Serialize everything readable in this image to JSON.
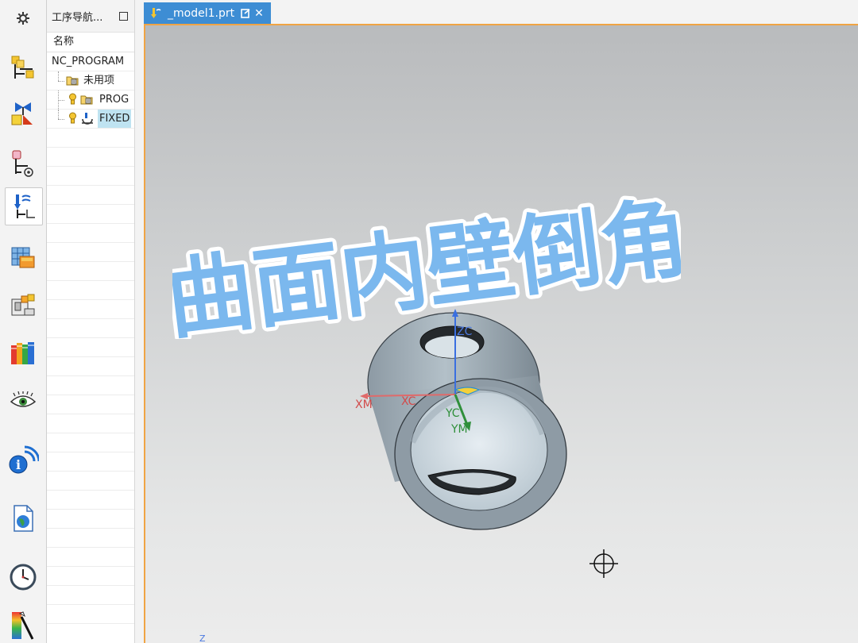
{
  "rail": {
    "items": [
      {
        "icon": "settings-gear-icon"
      },
      {
        "icon": "program-order-view-icon"
      },
      {
        "icon": "machine-tool-view-icon"
      },
      {
        "icon": "geometry-view-icon"
      },
      {
        "icon": "operation-navigator-icon",
        "active": true
      },
      {
        "icon": "machining-method-icon"
      },
      {
        "icon": "machine-tool-navigator-icon"
      },
      {
        "icon": "reuse-library-icon"
      },
      {
        "icon": "visibility-eye-icon"
      },
      {
        "icon": "information-icon"
      },
      {
        "icon": "web-browser-icon"
      },
      {
        "icon": "history-clock-icon"
      },
      {
        "icon": "color-palette-icon"
      }
    ]
  },
  "navigator": {
    "title": "工序导航...",
    "column_name": "名称",
    "tree": [
      {
        "label": "NC_PROGRAM",
        "level": 0
      },
      {
        "label": "未用项",
        "level": 1
      },
      {
        "label": "PROG",
        "level": 1
      },
      {
        "label": "FIXED",
        "level": 1,
        "selected": true
      }
    ]
  },
  "tab": {
    "label": "_model1.prt"
  },
  "viewport": {
    "overlay_title": "曲面内壁倒角",
    "axes": {
      "zc": "ZC",
      "xm": "XM",
      "xc": "XC",
      "yc": "YC",
      "ym": "YM"
    },
    "triad_label": "Z"
  },
  "colors": {
    "tab_active": "#3d8dd4",
    "accent_border": "#f0a444",
    "overlay_fill": "#7bb8ee",
    "overlay_stroke": "#ffffff",
    "part_body": "#9aa8b2"
  }
}
